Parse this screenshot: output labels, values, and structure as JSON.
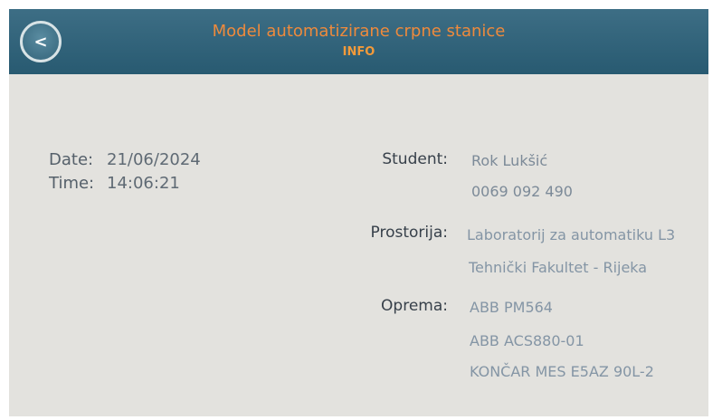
{
  "header": {
    "back_button": "<",
    "title": "Model automatizirane crpne stanice",
    "subtitle": "INFO"
  },
  "datetime": {
    "date_label": "Date:",
    "date_value": "21/06/2024",
    "time_label": "Time:",
    "time_value": "14:06:21"
  },
  "info": {
    "student_label": "Student:",
    "student_name": "Rok Lukšić",
    "student_id": "0069 092 490",
    "room_label": "Prostorija:",
    "room_line1": "Laboratorij za automatiku L3",
    "room_line2": "Tehnički Fakultet - Rijeka",
    "equipment_label": "Oprema:",
    "equipment": [
      "ABB PM564",
      "ABB ACS880-01",
      "KONČAR MES E5AZ 90L-2"
    ]
  },
  "colors": {
    "header_bg": "#2f6179",
    "title_orange": "#ee8a3c",
    "screen_bg": "#e3e2de"
  }
}
